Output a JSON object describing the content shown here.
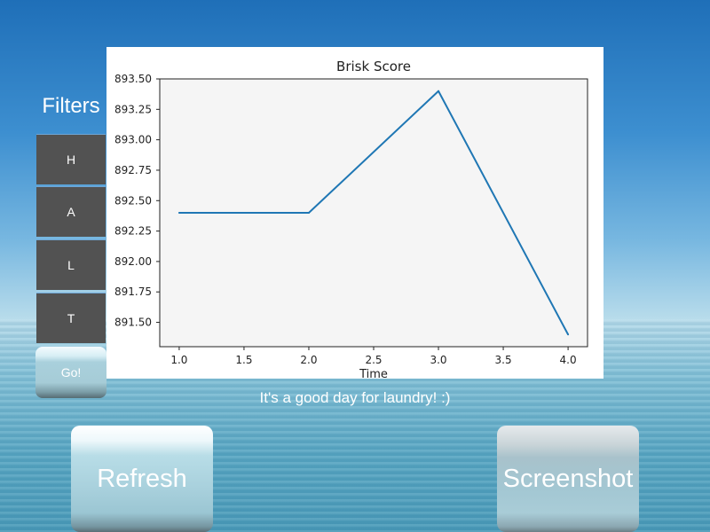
{
  "filters": {
    "title": "Filters",
    "buttons": [
      "H",
      "A",
      "L",
      "T"
    ],
    "go_label": "Go!"
  },
  "chart_data": {
    "type": "line",
    "title": "Brisk Score",
    "xlabel": "Time",
    "ylabel": "",
    "x": [
      1.0,
      2.0,
      3.0,
      4.0
    ],
    "series": [
      {
        "values": [
          892.4,
          892.4,
          893.4,
          891.4
        ],
        "color": "#1f77b4"
      }
    ],
    "xlim": [
      0.85,
      4.15
    ],
    "ylim": [
      891.3,
      893.5
    ],
    "xticks": [
      1.0,
      1.5,
      2.0,
      2.5,
      3.0,
      3.5,
      4.0
    ],
    "xtick_labels": [
      "1.0",
      "1.5",
      "2.0",
      "2.5",
      "3.0",
      "3.5",
      "4.0"
    ],
    "yticks": [
      891.5,
      891.75,
      892.0,
      892.25,
      892.5,
      892.75,
      893.0,
      893.25,
      893.5
    ],
    "ytick_labels": [
      "891.50",
      "891.75",
      "892.00",
      "892.25",
      "892.50",
      "892.75",
      "893.00",
      "893.25",
      "893.50"
    ],
    "plot_background": "#f5f5f5",
    "grid": false
  },
  "status": {
    "message": "It's a good day for laundry! :)"
  },
  "actions": {
    "refresh_label": "Refresh",
    "screenshot_label": "Screenshot"
  }
}
